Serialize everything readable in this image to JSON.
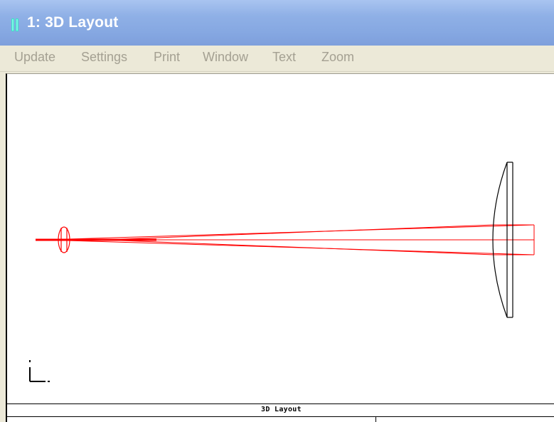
{
  "window": {
    "title": "1: 3D Layout"
  },
  "menu": {
    "items": [
      {
        "label": "Update"
      },
      {
        "label": "Settings"
      },
      {
        "label": "Print"
      },
      {
        "label": "Window"
      },
      {
        "label": "Text"
      },
      {
        "label": "Zoom"
      }
    ]
  },
  "layout_plot": {
    "footer_label": "3D Layout",
    "ray_color": "#ff0000",
    "lens_color": "#000000",
    "icons": [
      "app-icon",
      "axis-indicator-icon"
    ]
  }
}
